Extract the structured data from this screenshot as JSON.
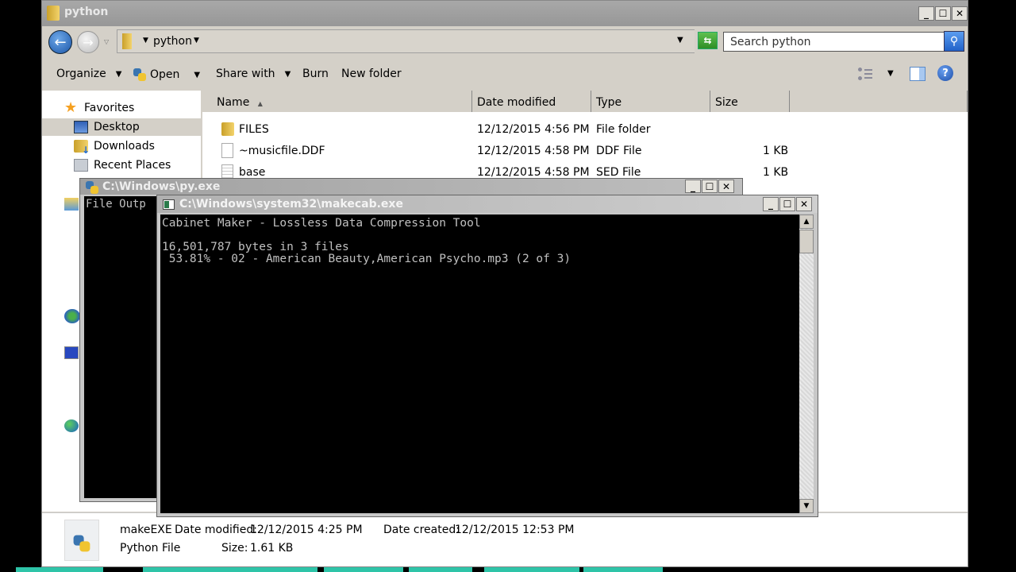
{
  "explorer": {
    "title": "python",
    "breadcrumb": [
      "python"
    ],
    "search_placeholder": "Search python",
    "toolbar": {
      "organize": "Organize",
      "open": "Open",
      "share_with": "Share with",
      "burn": "Burn",
      "new_folder": "New folder"
    },
    "nav": {
      "favorites": "Favorites",
      "items": [
        {
          "label": "Desktop",
          "icon": "desktop-icon",
          "selected": true
        },
        {
          "label": "Downloads",
          "icon": "downloads-folder-icon"
        },
        {
          "label": "Recent Places",
          "icon": "recent-places-icon"
        }
      ]
    },
    "columns": {
      "name": "Name",
      "date_modified": "Date modified",
      "type": "Type",
      "size": "Size"
    },
    "files": [
      {
        "name": "FILES",
        "date": "12/12/2015 4:56 PM",
        "type": "File folder",
        "size": ""
      },
      {
        "name": "~musicfile.DDF",
        "date": "12/12/2015 4:58 PM",
        "type": "DDF File",
        "size": "1 KB"
      },
      {
        "name": "base",
        "date": "12/12/2015 4:58 PM",
        "type": "SED File",
        "size": "1 KB"
      }
    ],
    "details": {
      "name": "makeEXE",
      "type": "Python File",
      "date_modified_label": "Date modified:",
      "date_modified": "12/12/2015 4:25 PM",
      "date_created_label": "Date created:",
      "date_created": "12/12/2015 12:53 PM",
      "size_label": "Size:",
      "size": "1.61 KB"
    }
  },
  "py_console": {
    "title": "C:\\Windows\\py.exe",
    "output": "File Outp"
  },
  "makecab_console": {
    "title": "C:\\Windows\\system32\\makecab.exe",
    "lines": [
      "Cabinet Maker - Lossless Data Compression Tool",
      "",
      "16,501,787 bytes in 3 files",
      " 53.81% - 02 - American Beauty,American Psycho.mp3 (2 of 3)"
    ]
  },
  "window_buttons": {
    "minimize": "_",
    "maximize": "☐",
    "close": "✕"
  }
}
